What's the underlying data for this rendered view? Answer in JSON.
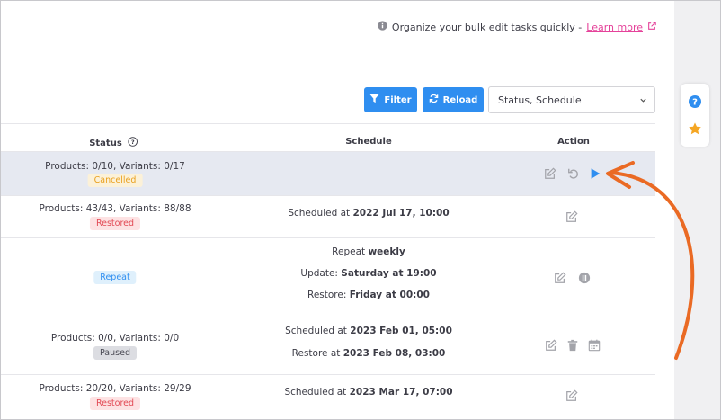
{
  "info": {
    "text": "Organize your bulk edit tasks quickly - ",
    "link": "Learn more"
  },
  "toolbar": {
    "filter_label": "Filter",
    "reload_label": "Reload",
    "select_value": "Status, Schedule"
  },
  "table": {
    "headers": {
      "status": "Status",
      "schedule": "Schedule",
      "action": "Action"
    },
    "rows": [
      {
        "status_text": "Products: 0/10, Variants: 0/17",
        "badge": "Cancelled"
      },
      {
        "status_text": "Products: 43/43, Variants: 88/88",
        "badge": "Restored",
        "schedule_prefix": "Scheduled at ",
        "schedule_value": "2022 Jul 17, 10:00"
      },
      {
        "badge": "Repeat",
        "line1_prefix": "Repeat ",
        "line1_value": "weekly",
        "line2_prefix": "Update: ",
        "line2_value": "Saturday at 19:00",
        "line3_prefix": "Restore: ",
        "line3_value": "Friday at 00:00"
      },
      {
        "status_text": "Products: 0/0, Variants: 0/0",
        "badge": "Paused",
        "line1_prefix": "Scheduled at ",
        "line1_value": "2023 Feb 01, 05:00",
        "line2_prefix": "Restore at ",
        "line2_value": "2023 Feb 08, 03:00"
      },
      {
        "status_text": "Products: 20/20, Variants: 29/29",
        "badge": "Restored",
        "schedule_prefix": "Scheduled at ",
        "schedule_value": "2023 Mar 17, 07:00"
      }
    ]
  },
  "icons": {
    "info": "info-circle-icon",
    "external": "external-link-icon",
    "filter": "funnel-icon",
    "reload": "refresh-icon",
    "help": "question-circle-icon",
    "star": "star-icon",
    "edit": "edit-icon",
    "undo": "undo-icon",
    "play": "play-icon",
    "pause": "pause-icon",
    "trash": "trash-icon",
    "calendar": "calendar-icon"
  },
  "colors": {
    "primary": "#2f8ef0",
    "accent_link": "#e5429a",
    "annotation_arrow": "#ea6a24",
    "star": "#f5a623"
  }
}
